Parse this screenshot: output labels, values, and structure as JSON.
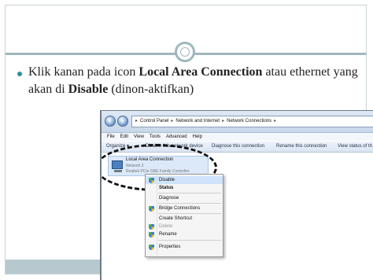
{
  "slide": {
    "text_before": "Klik kanan pada icon ",
    "text_bold1": "Local Area Connection",
    "text_mid": " atau ethernet yang akan di ",
    "text_bold2": "Disable",
    "text_after": " (dinon-aktifkan)"
  },
  "explorer": {
    "address": [
      "Control Panel",
      "Network and Internet",
      "Network Connections"
    ],
    "menu": [
      "File",
      "Edit",
      "View",
      "Tools",
      "Advanced",
      "Help"
    ],
    "commands": [
      "Organize ▾",
      "Disable this network device",
      "Diagnose this connection",
      "Rename this connection",
      "View status of th"
    ],
    "item": {
      "name": "Local Area Connection",
      "network": "Network 2",
      "adapter": "Realtek PCIe GBE Family Controller"
    }
  },
  "context_menu": [
    {
      "label": "Disable",
      "shield": true
    },
    {
      "label": "Status",
      "bold": true
    },
    {
      "label": "Diagnose"
    },
    {
      "label": "Bridge Connections",
      "shield": true
    },
    {
      "label": "Create Shortcut"
    },
    {
      "label": "Delete",
      "shield": true,
      "disabled": true
    },
    {
      "label": "Rename",
      "shield": true
    },
    {
      "label": "Properties",
      "shield": true
    }
  ]
}
